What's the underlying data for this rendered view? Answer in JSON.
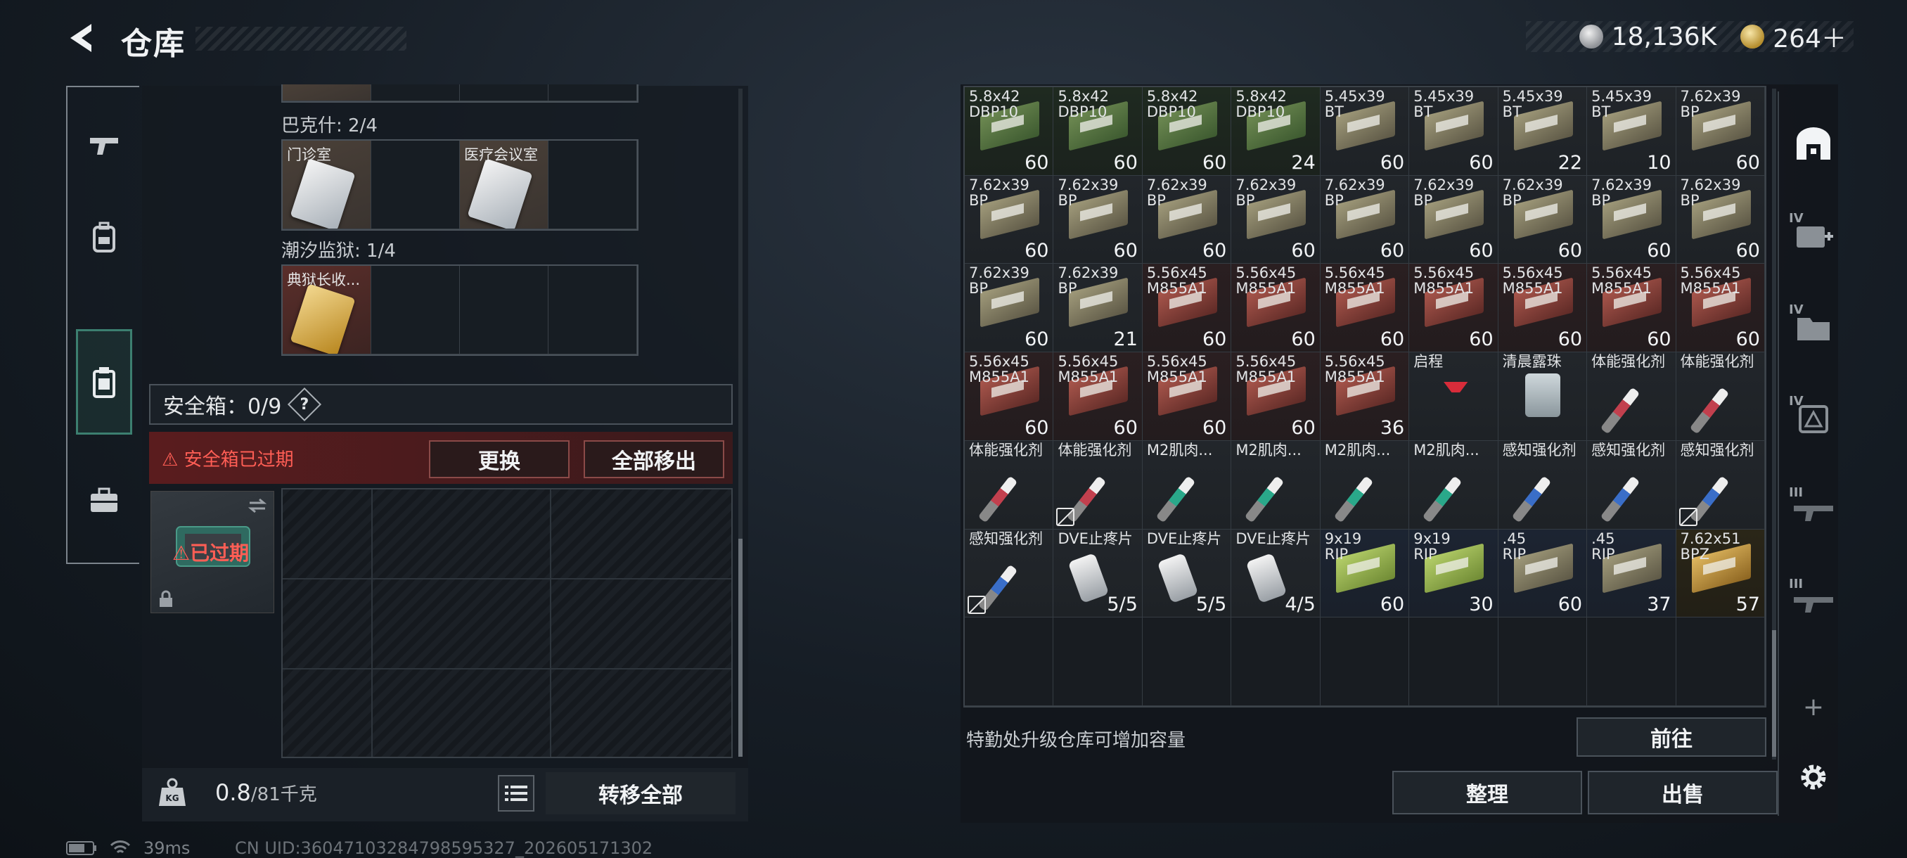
{
  "header": {
    "title": "仓库",
    "currency_silver": "18,136K",
    "currency_gold": "264＋"
  },
  "left_nav": {
    "items": [
      "gun-icon",
      "backpack-icon",
      "clipboard-icon",
      "briefcase-icon"
    ],
    "active": "clipboard-icon"
  },
  "keycards": {
    "group1_label": "巴克什: 2/4",
    "group1_items": [
      "门诊室",
      "",
      "医疗会议室",
      ""
    ],
    "group2_label": "潮汐监狱: 1/4",
    "group2_items": [
      "典狱长收...",
      "",
      "",
      ""
    ]
  },
  "safe_box": {
    "label": "安全箱：0/9",
    "help": "?",
    "expired_notice": "⚠ 安全箱已过期",
    "replace_button": "更换",
    "move_all_button": "全部移出",
    "case_status": "⚠已过期"
  },
  "footer_left": {
    "weight_current": "0.8",
    "weight_max": "/81千克",
    "transfer_all": "转移全部"
  },
  "stash": {
    "items": [
      {
        "name": "5.8x42\nDBP10",
        "count": "60",
        "bg": "green",
        "icon": "green"
      },
      {
        "name": "5.8x42\nDBP10",
        "count": "60",
        "bg": "green",
        "icon": "green"
      },
      {
        "name": "5.8x42\nDBP10",
        "count": "60",
        "bg": "green",
        "icon": "green"
      },
      {
        "name": "5.8x42\nDBP10",
        "count": "24",
        "bg": "green",
        "icon": "green"
      },
      {
        "name": "5.45x39\nBT",
        "count": "60",
        "bg": "gray",
        "icon": "tan"
      },
      {
        "name": "5.45x39\nBT",
        "count": "60",
        "bg": "gray",
        "icon": "tan"
      },
      {
        "name": "5.45x39\nBT",
        "count": "22",
        "bg": "gray",
        "icon": "tan"
      },
      {
        "name": "5.45x39\nBT",
        "count": "10",
        "bg": "gray",
        "icon": "tan"
      },
      {
        "name": "7.62x39\nBP",
        "count": "60",
        "bg": "gray",
        "icon": "tan"
      },
      {
        "name": "7.62x39\nBP",
        "count": "60",
        "bg": "gray",
        "icon": "tan"
      },
      {
        "name": "7.62x39\nBP",
        "count": "60",
        "bg": "gray",
        "icon": "tan"
      },
      {
        "name": "7.62x39\nBP",
        "count": "60",
        "bg": "gray",
        "icon": "tan"
      },
      {
        "name": "7.62x39\nBP",
        "count": "60",
        "bg": "gray",
        "icon": "tan"
      },
      {
        "name": "7.62x39\nBP",
        "count": "60",
        "bg": "gray",
        "icon": "tan"
      },
      {
        "name": "7.62x39\nBP",
        "count": "60",
        "bg": "gray",
        "icon": "tan"
      },
      {
        "name": "7.62x39\nBP",
        "count": "60",
        "bg": "gray",
        "icon": "tan"
      },
      {
        "name": "7.62x39\nBP",
        "count": "60",
        "bg": "gray",
        "icon": "tan"
      },
      {
        "name": "7.62x39\nBP",
        "count": "60",
        "bg": "gray",
        "icon": "tan"
      },
      {
        "name": "7.62x39\nBP",
        "count": "60",
        "bg": "gray",
        "icon": "tan"
      },
      {
        "name": "7.62x39\nBP",
        "count": "21",
        "bg": "gray",
        "icon": "tan"
      },
      {
        "name": "5.56x45\nM855A1",
        "count": "60",
        "bg": "red",
        "icon": "red"
      },
      {
        "name": "5.56x45\nM855A1",
        "count": "60",
        "bg": "red",
        "icon": "red"
      },
      {
        "name": "5.56x45\nM855A1",
        "count": "60",
        "bg": "red",
        "icon": "red"
      },
      {
        "name": "5.56x45\nM855A1",
        "count": "60",
        "bg": "red",
        "icon": "red"
      },
      {
        "name": "5.56x45\nM855A1",
        "count": "60",
        "bg": "red",
        "icon": "red"
      },
      {
        "name": "5.56x45\nM855A1",
        "count": "60",
        "bg": "red",
        "icon": "red"
      },
      {
        "name": "5.56x45\nM855A1",
        "count": "60",
        "bg": "red",
        "icon": "red"
      },
      {
        "name": "5.56x45\nM855A1",
        "count": "60",
        "bg": "red",
        "icon": "red"
      },
      {
        "name": "5.56x45\nM855A1",
        "count": "60",
        "bg": "red",
        "icon": "red"
      },
      {
        "name": "5.56x45\nM855A1",
        "count": "60",
        "bg": "red",
        "icon": "red"
      },
      {
        "name": "5.56x45\nM855A1",
        "count": "60",
        "bg": "red",
        "icon": "red"
      },
      {
        "name": "5.56x45\nM855A1",
        "count": "36",
        "bg": "red",
        "icon": "red"
      },
      {
        "name": "启程",
        "count": "",
        "bg": "gray",
        "icon": "cocktail"
      },
      {
        "name": "清晨露珠",
        "count": "",
        "bg": "gray",
        "icon": "jar"
      },
      {
        "name": "体能强化剂",
        "count": "",
        "bg": "gray",
        "icon": "syringe-red"
      },
      {
        "name": "体能强化剂",
        "count": "",
        "bg": "gray",
        "icon": "syringe-red"
      },
      {
        "name": "体能强化剂",
        "count": "",
        "bg": "gray",
        "icon": "syringe-red"
      },
      {
        "name": "体能强化剂",
        "count": "",
        "bg": "gray",
        "icon": "syringe-red",
        "locked": true
      },
      {
        "name": "M2肌肉...",
        "count": "",
        "bg": "gray",
        "icon": "syringe-teal"
      },
      {
        "name": "M2肌肉...",
        "count": "",
        "bg": "gray",
        "icon": "syringe-teal"
      },
      {
        "name": "M2肌肉...",
        "count": "",
        "bg": "gray",
        "icon": "syringe-teal"
      },
      {
        "name": "M2肌肉...",
        "count": "",
        "bg": "gray",
        "icon": "syringe-teal"
      },
      {
        "name": "感知强化剂",
        "count": "",
        "bg": "gray",
        "icon": "syringe-blue"
      },
      {
        "name": "感知强化剂",
        "count": "",
        "bg": "gray",
        "icon": "syringe-blue"
      },
      {
        "name": "感知强化剂",
        "count": "",
        "bg": "gray",
        "icon": "syringe-blue",
        "locked": true
      },
      {
        "name": "感知强化剂",
        "count": "",
        "bg": "gray",
        "icon": "syringe-blue",
        "locked": true
      },
      {
        "name": "DVE止疼片",
        "count": "5/5",
        "bg": "gray",
        "icon": "pill"
      },
      {
        "name": "DVE止疼片",
        "count": "5/5",
        "bg": "gray",
        "icon": "pill"
      },
      {
        "name": "DVE止疼片",
        "count": "4/5",
        "bg": "gray",
        "icon": "pill"
      },
      {
        "name": "9x19\nRIP",
        "count": "60",
        "bg": "blue",
        "icon": "lime"
      },
      {
        "name": "9x19\nRIP",
        "count": "30",
        "bg": "blue",
        "icon": "lime"
      },
      {
        "name": ".45\nRIP",
        "count": "60",
        "bg": "blue",
        "icon": "tan"
      },
      {
        "name": ".45\nRIP",
        "count": "37",
        "bg": "blue",
        "icon": "tan"
      },
      {
        "name": "7.62x51\nBPZ",
        "count": "57",
        "bg": "gold",
        "icon": "gold"
      }
    ],
    "upgrade_tip": "特勤处升级仓库可增加容量",
    "goto_button": "前往",
    "sort_button": "整理",
    "sell_button": "出售"
  },
  "right_nav": {
    "roman_labels": [
      "IV",
      "IV",
      "IV",
      "III",
      "III"
    ],
    "plus": "+"
  },
  "status_bar": {
    "ping": "39ms",
    "uid": "CN UID:36047103284798595327_202605171302"
  },
  "colors": {
    "accent_teal": "#3c7f70",
    "warning_red": "#ff5e55",
    "expired_bg": "#5a1c1e"
  }
}
